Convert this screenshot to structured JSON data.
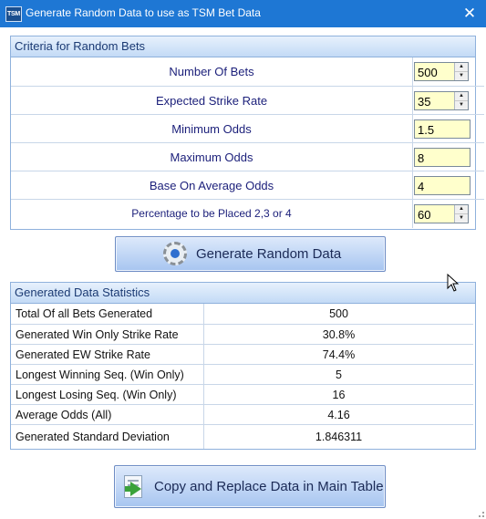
{
  "window": {
    "app_icon_text": "TSM",
    "title": "Generate Random Data to use as TSM Bet Data",
    "close_glyph": "✕"
  },
  "criteria": {
    "header": "Criteria for Random Bets",
    "rows": [
      {
        "label": "Number Of Bets",
        "value": "500",
        "spinner": true
      },
      {
        "label": "Expected Strike Rate",
        "value": "35",
        "spinner": true
      },
      {
        "label": "Minimum Odds",
        "value": "1.5",
        "spinner": false
      },
      {
        "label": "Maximum Odds",
        "value": "8",
        "spinner": false
      },
      {
        "label": "Base On Average Odds",
        "value": "4",
        "spinner": false
      },
      {
        "label": "Percentage to be Placed 2,3 or 4",
        "value": "60",
        "spinner": true
      }
    ],
    "spin_up": "▲",
    "spin_down": "▼"
  },
  "generate_button": {
    "label": "Generate Random Data",
    "icon": "gear-play-icon"
  },
  "stats": {
    "header": "Generated Data Statistics",
    "rows": [
      {
        "label": "Total Of all Bets Generated",
        "value": "500"
      },
      {
        "label": "Generated Win Only Strike Rate",
        "value": "30.8%"
      },
      {
        "label": "Generated EW Strike Rate",
        "value": "74.4%"
      },
      {
        "label": "Longest Winning Seq. (Win Only)",
        "value": "5"
      },
      {
        "label": "Longest Losing Seq. (Win Only)",
        "value": "16"
      },
      {
        "label": "Average Odds (All)",
        "value": "4.16"
      },
      {
        "label": "Generated Standard Deviation",
        "value": "1.846311"
      }
    ]
  },
  "copy_button": {
    "label": "Copy and Replace Data in Main Table",
    "icon": "document-arrow-icon"
  },
  "colors": {
    "titlebar": "#1e77d4",
    "panel_header": "#c3daf6",
    "input_background": "#ffffcc",
    "label_text": "#1b1f7a"
  }
}
